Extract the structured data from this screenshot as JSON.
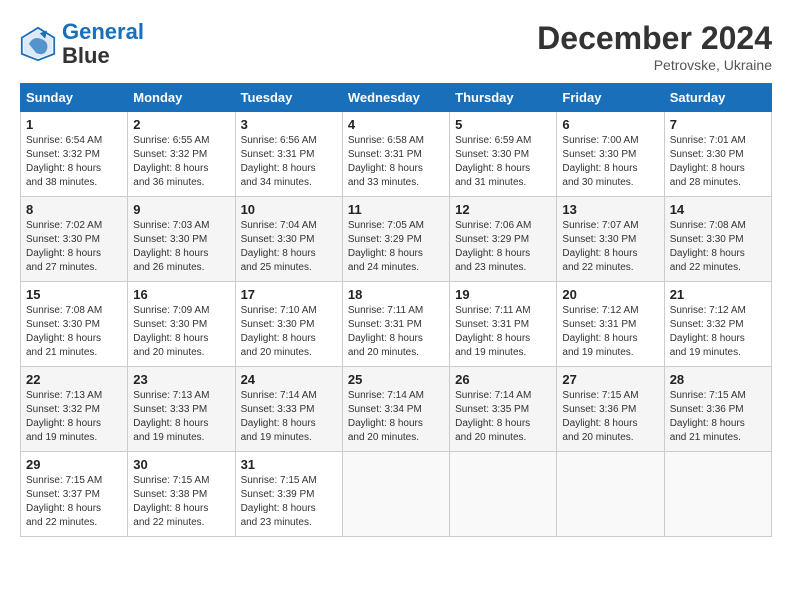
{
  "header": {
    "logo_line1": "General",
    "logo_line2": "Blue",
    "month": "December 2024",
    "location": "Petrovske, Ukraine"
  },
  "days_of_week": [
    "Sunday",
    "Monday",
    "Tuesday",
    "Wednesday",
    "Thursday",
    "Friday",
    "Saturday"
  ],
  "weeks": [
    [
      {
        "day": "1",
        "info": "Sunrise: 6:54 AM\nSunset: 3:32 PM\nDaylight: 8 hours\nand 38 minutes."
      },
      {
        "day": "2",
        "info": "Sunrise: 6:55 AM\nSunset: 3:32 PM\nDaylight: 8 hours\nand 36 minutes."
      },
      {
        "day": "3",
        "info": "Sunrise: 6:56 AM\nSunset: 3:31 PM\nDaylight: 8 hours\nand 34 minutes."
      },
      {
        "day": "4",
        "info": "Sunrise: 6:58 AM\nSunset: 3:31 PM\nDaylight: 8 hours\nand 33 minutes."
      },
      {
        "day": "5",
        "info": "Sunrise: 6:59 AM\nSunset: 3:30 PM\nDaylight: 8 hours\nand 31 minutes."
      },
      {
        "day": "6",
        "info": "Sunrise: 7:00 AM\nSunset: 3:30 PM\nDaylight: 8 hours\nand 30 minutes."
      },
      {
        "day": "7",
        "info": "Sunrise: 7:01 AM\nSunset: 3:30 PM\nDaylight: 8 hours\nand 28 minutes."
      }
    ],
    [
      {
        "day": "8",
        "info": "Sunrise: 7:02 AM\nSunset: 3:30 PM\nDaylight: 8 hours\nand 27 minutes."
      },
      {
        "day": "9",
        "info": "Sunrise: 7:03 AM\nSunset: 3:30 PM\nDaylight: 8 hours\nand 26 minutes."
      },
      {
        "day": "10",
        "info": "Sunrise: 7:04 AM\nSunset: 3:30 PM\nDaylight: 8 hours\nand 25 minutes."
      },
      {
        "day": "11",
        "info": "Sunrise: 7:05 AM\nSunset: 3:29 PM\nDaylight: 8 hours\nand 24 minutes."
      },
      {
        "day": "12",
        "info": "Sunrise: 7:06 AM\nSunset: 3:29 PM\nDaylight: 8 hours\nand 23 minutes."
      },
      {
        "day": "13",
        "info": "Sunrise: 7:07 AM\nSunset: 3:30 PM\nDaylight: 8 hours\nand 22 minutes."
      },
      {
        "day": "14",
        "info": "Sunrise: 7:08 AM\nSunset: 3:30 PM\nDaylight: 8 hours\nand 22 minutes."
      }
    ],
    [
      {
        "day": "15",
        "info": "Sunrise: 7:08 AM\nSunset: 3:30 PM\nDaylight: 8 hours\nand 21 minutes."
      },
      {
        "day": "16",
        "info": "Sunrise: 7:09 AM\nSunset: 3:30 PM\nDaylight: 8 hours\nand 20 minutes."
      },
      {
        "day": "17",
        "info": "Sunrise: 7:10 AM\nSunset: 3:30 PM\nDaylight: 8 hours\nand 20 minutes."
      },
      {
        "day": "18",
        "info": "Sunrise: 7:11 AM\nSunset: 3:31 PM\nDaylight: 8 hours\nand 20 minutes."
      },
      {
        "day": "19",
        "info": "Sunrise: 7:11 AM\nSunset: 3:31 PM\nDaylight: 8 hours\nand 19 minutes."
      },
      {
        "day": "20",
        "info": "Sunrise: 7:12 AM\nSunset: 3:31 PM\nDaylight: 8 hours\nand 19 minutes."
      },
      {
        "day": "21",
        "info": "Sunrise: 7:12 AM\nSunset: 3:32 PM\nDaylight: 8 hours\nand 19 minutes."
      }
    ],
    [
      {
        "day": "22",
        "info": "Sunrise: 7:13 AM\nSunset: 3:32 PM\nDaylight: 8 hours\nand 19 minutes."
      },
      {
        "day": "23",
        "info": "Sunrise: 7:13 AM\nSunset: 3:33 PM\nDaylight: 8 hours\nand 19 minutes."
      },
      {
        "day": "24",
        "info": "Sunrise: 7:14 AM\nSunset: 3:33 PM\nDaylight: 8 hours\nand 19 minutes."
      },
      {
        "day": "25",
        "info": "Sunrise: 7:14 AM\nSunset: 3:34 PM\nDaylight: 8 hours\nand 20 minutes."
      },
      {
        "day": "26",
        "info": "Sunrise: 7:14 AM\nSunset: 3:35 PM\nDaylight: 8 hours\nand 20 minutes."
      },
      {
        "day": "27",
        "info": "Sunrise: 7:15 AM\nSunset: 3:36 PM\nDaylight: 8 hours\nand 20 minutes."
      },
      {
        "day": "28",
        "info": "Sunrise: 7:15 AM\nSunset: 3:36 PM\nDaylight: 8 hours\nand 21 minutes."
      }
    ],
    [
      {
        "day": "29",
        "info": "Sunrise: 7:15 AM\nSunset: 3:37 PM\nDaylight: 8 hours\nand 22 minutes."
      },
      {
        "day": "30",
        "info": "Sunrise: 7:15 AM\nSunset: 3:38 PM\nDaylight: 8 hours\nand 22 minutes."
      },
      {
        "day": "31",
        "info": "Sunrise: 7:15 AM\nSunset: 3:39 PM\nDaylight: 8 hours\nand 23 minutes."
      },
      {
        "day": "",
        "info": ""
      },
      {
        "day": "",
        "info": ""
      },
      {
        "day": "",
        "info": ""
      },
      {
        "day": "",
        "info": ""
      }
    ]
  ]
}
